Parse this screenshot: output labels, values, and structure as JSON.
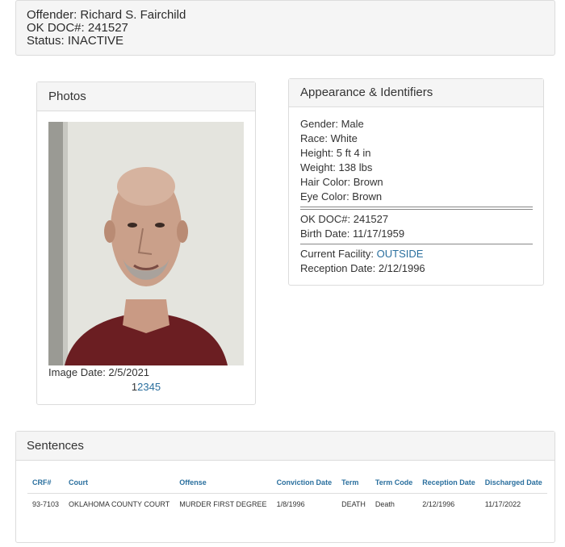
{
  "header": {
    "offender": "Offender: Richard S. Fairchild",
    "doc": "OK DOC#: 241527",
    "status": "Status: INACTIVE"
  },
  "photos": {
    "title": "Photos",
    "image_date": "Image Date: 2/5/2021",
    "pages": [
      "1",
      "2",
      "3",
      "4",
      "5"
    ]
  },
  "appearance": {
    "title": "Appearance & Identifiers",
    "gender": "Gender: Male",
    "race": "Race: White",
    "height": "Height: 5 ft 4 in",
    "weight": "Weight: 138 lbs",
    "hair": "Hair Color: Brown",
    "eye": "Eye Color: Brown",
    "doc": "OK DOC#: 241527",
    "birth": "Birth Date: 11/17/1959",
    "facility_label": "Current Facility: ",
    "facility_value": "OUTSIDE",
    "reception": "Reception Date: 2/12/1996"
  },
  "sentences": {
    "title": "Sentences",
    "columns": [
      "CRF#",
      "Court",
      "Offense",
      "Conviction Date",
      "Term",
      "Term Code",
      "Reception Date",
      "Discharged Date"
    ],
    "rows": [
      [
        "93-7103",
        "OKLAHOMA COUNTY COURT",
        "MURDER FIRST DEGREE",
        "1/8/1996",
        "DEATH",
        "Death",
        "2/12/1996",
        "11/17/2022"
      ]
    ]
  },
  "colors": {
    "link": "#2a6f9e",
    "panel_header": "#f5f5f5",
    "border": "#dcdcdc"
  }
}
